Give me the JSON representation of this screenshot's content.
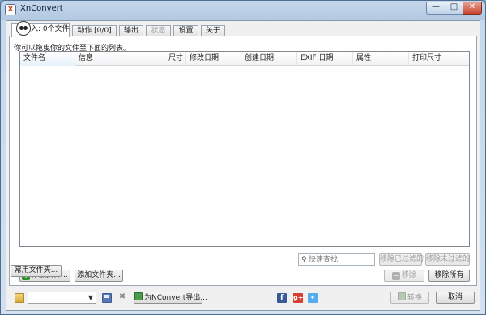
{
  "window": {
    "title": "XnConvert"
  },
  "controls": {
    "minimize": "—",
    "maximize": "□",
    "close": "✕"
  },
  "tabs": [
    {
      "label": "输入: 0个文件",
      "active": true,
      "disabled": false
    },
    {
      "label": "动作 [0/0]",
      "active": false,
      "disabled": false
    },
    {
      "label": "输出",
      "active": false,
      "disabled": false
    },
    {
      "label": "状态",
      "active": false,
      "disabled": true
    },
    {
      "label": "设置",
      "active": false,
      "disabled": false
    },
    {
      "label": "关于",
      "active": false,
      "disabled": false
    }
  ],
  "input_tab": {
    "hint": "你可以拖曳你的文件至下面的列表。",
    "columns": [
      "文件名",
      "信息",
      "尺寸",
      "修改日期",
      "创建日期",
      "EXIF 日期",
      "属性",
      "打印尺寸"
    ],
    "rows": [],
    "search_placeholder": "快速查找",
    "remove_filtered": "移除已过滤的",
    "remove_unfiltered": "移除未过滤的",
    "add_files": "添加文件...",
    "add_folder": "添加文件夹...",
    "common_folders": "常用文件夹...",
    "remove": "移除",
    "remove_all": "移除所有"
  },
  "bottom": {
    "preset_value": "",
    "export_label": "为NConvert导出...",
    "convert_label": "转换",
    "cancel_label": "取消",
    "icons": [
      "folder-icon",
      "save-icon",
      "delete-icon",
      "facebook-icon",
      "google-plus-icon",
      "twitter-icon"
    ]
  },
  "colors": {
    "title_bar": "#b3c9e2",
    "client_background": "#f0f0f0",
    "list_background": "#ffffff"
  }
}
